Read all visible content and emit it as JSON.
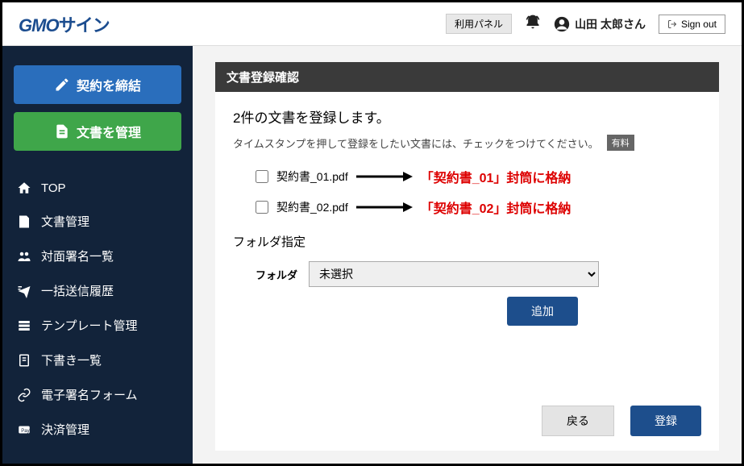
{
  "header": {
    "logo_gmo": "GMO",
    "logo_sign": "サイン",
    "panel_btn": "利用パネル",
    "user_name": "山田 太郎さん",
    "signout": "Sign out"
  },
  "sidebar": {
    "contract_btn": "契約を締結",
    "manage_btn": "文書を管理",
    "items": [
      {
        "label": "TOP"
      },
      {
        "label": "文書管理"
      },
      {
        "label": "対面署名一覧"
      },
      {
        "label": "一括送信履歴"
      },
      {
        "label": "テンプレート管理"
      },
      {
        "label": "下書き一覧"
      },
      {
        "label": "電子署名フォーム"
      },
      {
        "label": "決済管理"
      }
    ]
  },
  "main": {
    "section_title": "文書登録確認",
    "register_title": "2件の文書を登録します。",
    "register_desc": "タイムスタンプを押して登録をしたい文書には、チェックをつけてください。",
    "paid_badge": "有料",
    "files": [
      {
        "name": "契約書_01.pdf",
        "annotation": "「契約書_01」封筒に格納"
      },
      {
        "name": "契約書_02.pdf",
        "annotation": "「契約書_02」封筒に格納"
      }
    ],
    "folder_section_title": "フォルダ指定",
    "folder_label": "フォルダ",
    "folder_selected": "未選択",
    "add_btn": "追加",
    "back_btn": "戻る",
    "register_btn": "登録"
  }
}
